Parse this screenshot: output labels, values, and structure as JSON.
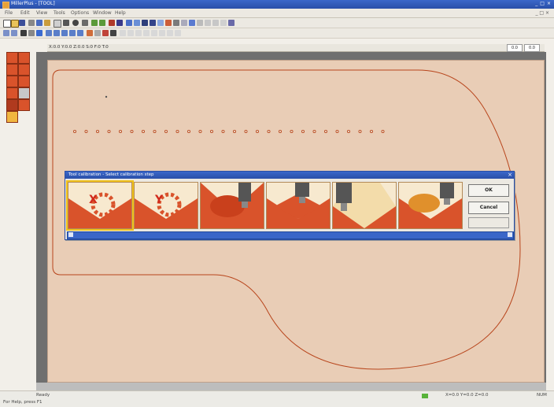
{
  "window": {
    "title": "MillerPlus - [TOOL]",
    "controls": [
      "_",
      "□",
      "×"
    ]
  },
  "menu": {
    "items": [
      "File",
      "Edit",
      "View",
      "Tools",
      "Options",
      "Window",
      "Help"
    ],
    "mdi": "_ □ ×"
  },
  "coordbar": {
    "text": "X:0.0 Y:0.0 Z:0.0 S:0 F:0 T:0",
    "box1": "0.0",
    "box2": "0.0"
  },
  "dialog": {
    "title": "Tool calibration - Select calibration step",
    "ok": "OK",
    "cancel": "Cancel",
    "tiles": [
      {
        "name": "x-axis-calibration",
        "letter": "X"
      },
      {
        "name": "y-axis-calibration",
        "letter": "Y"
      },
      {
        "name": "z-touch-red",
        "letter": ""
      },
      {
        "name": "z-touch-red-2",
        "letter": ""
      },
      {
        "name": "z-touch-yellow",
        "letter": ""
      },
      {
        "name": "z-touch-orange",
        "letter": ""
      }
    ]
  },
  "status": {
    "left": "Ready",
    "mode": "For Help, press F1",
    "coords": "X=0.0  Y=0.0  Z=0.0",
    "num": "NUM"
  },
  "colors": {
    "accent": "#2a4fa8",
    "workpiece": "#e9cdb6",
    "outline": "#b8451c"
  }
}
